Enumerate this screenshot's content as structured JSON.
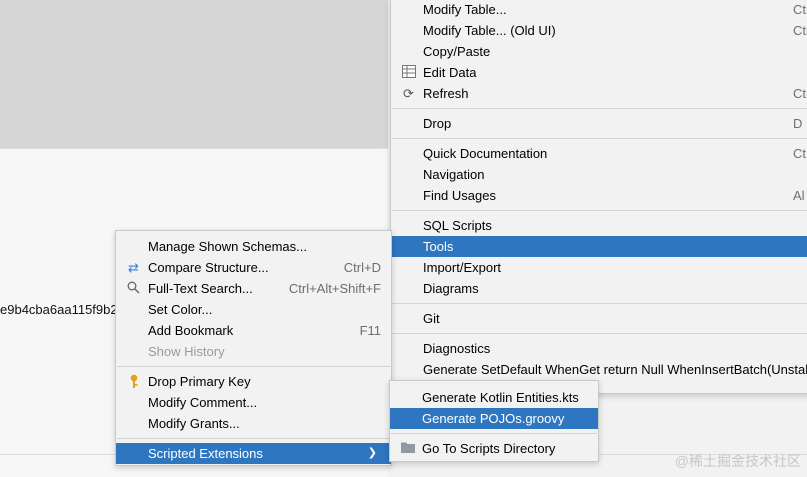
{
  "background": {
    "hash_text": "e9b4cba6aa115f9b2"
  },
  "main_menu": {
    "items": [
      {
        "label": "Modify Table...",
        "shortcut": "Ctr"
      },
      {
        "label": "Modify Table... (Old UI)",
        "shortcut": "Ctr"
      },
      {
        "label": "Copy/Paste",
        "shortcut": ""
      },
      {
        "label": "Edit Data",
        "shortcut": "",
        "icon": "table-icon"
      },
      {
        "label": "Refresh",
        "shortcut": "Ctr",
        "icon": "refresh-icon"
      },
      {
        "label": "Drop",
        "shortcut": "D"
      },
      {
        "label": "Quick Documentation",
        "shortcut": "Ct"
      },
      {
        "label": "Navigation",
        "shortcut": ""
      },
      {
        "label": "Find Usages",
        "shortcut": "Al"
      },
      {
        "label": "SQL Scripts",
        "shortcut": ""
      },
      {
        "label": "Tools",
        "shortcut": ""
      },
      {
        "label": "Import/Export",
        "shortcut": ""
      },
      {
        "label": "Diagrams",
        "shortcut": ""
      },
      {
        "label": "Git",
        "shortcut": ""
      },
      {
        "label": "Diagnostics",
        "shortcut": ""
      },
      {
        "label": "Generate SetDefault WhenGet return Null WhenInsertBatch(Unstab",
        "shortcut": ""
      }
    ]
  },
  "tools_submenu": {
    "items": [
      {
        "label": "Manage Shown Schemas...",
        "shortcut": ""
      },
      {
        "label": "Compare Structure...",
        "shortcut": "Ctrl+D",
        "icon": "compare-icon"
      },
      {
        "label": "Full-Text Search...",
        "shortcut": "Ctrl+Alt+Shift+F",
        "icon": "search-icon"
      },
      {
        "label": "Set Color...",
        "shortcut": ""
      },
      {
        "label": "Add Bookmark",
        "shortcut": "F11"
      },
      {
        "label": "Show History",
        "shortcut": ""
      },
      {
        "label": "Drop Primary Key",
        "shortcut": "",
        "icon": "key-icon"
      },
      {
        "label": "Modify Comment...",
        "shortcut": ""
      },
      {
        "label": "Modify Grants...",
        "shortcut": ""
      },
      {
        "label": "Scripted Extensions",
        "shortcut": "",
        "arrow": "❯"
      }
    ]
  },
  "scripts_submenu": {
    "items": [
      {
        "label": "Generate Kotlin Entities.kts"
      },
      {
        "label": "Generate POJOs.groovy"
      },
      {
        "label": "Go To Scripts Directory",
        "icon": "folder-icon"
      }
    ]
  },
  "watermark": "@稀土掘金技术社区",
  "colors": {
    "selection": "#2f76c0",
    "menu_bg": "#f2f2f2"
  }
}
